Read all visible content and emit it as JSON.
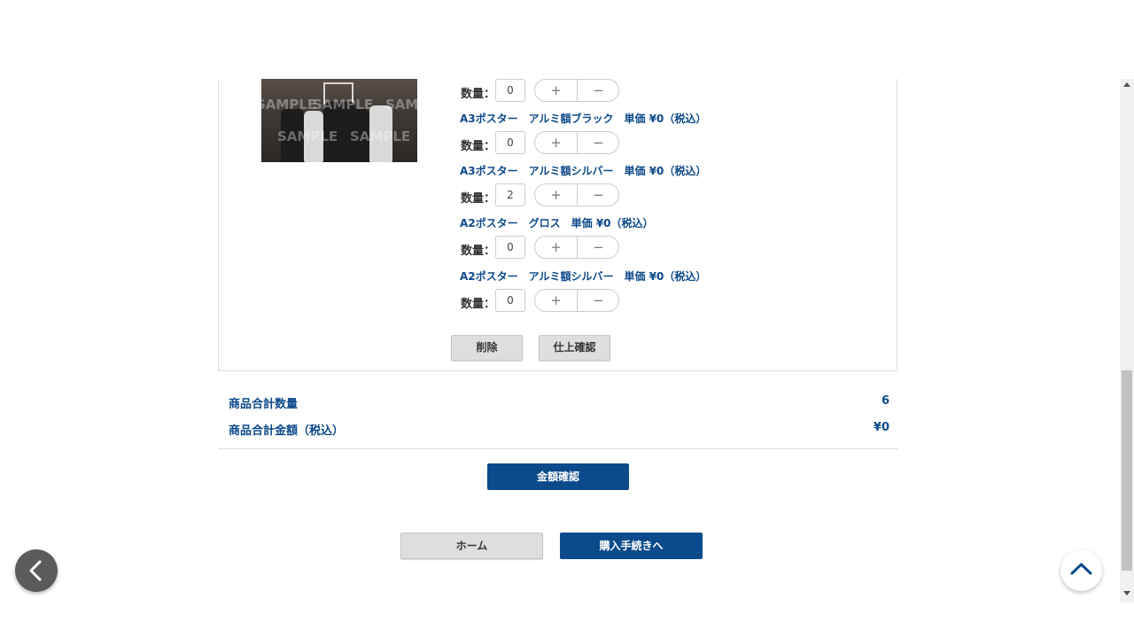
{
  "thumbnail": {
    "watermark": "SAMPLE"
  },
  "quantity_label": "数量：",
  "quantity_rows": [
    {
      "value": "0"
    },
    {
      "title": "A3ポスター　アルミ額ブラック　単価 ¥0（税込）",
      "value": "0"
    },
    {
      "title": "A3ポスター　アルミ額シルバー　単価 ¥0（税込）",
      "value": "2"
    },
    {
      "title": "A2ポスター　グロス　単価 ¥0（税込）",
      "value": "0"
    },
    {
      "title": "A2ポスター　アルミ額シルバー　単価 ¥0（税込）",
      "value": "0"
    }
  ],
  "stepper": {
    "plus": "+",
    "minus": "−"
  },
  "actions": {
    "delete": "削除",
    "finish_check": "仕上確認"
  },
  "summary": {
    "total_qty_label": "商品合計数量",
    "total_qty_value": "6",
    "total_price_label": "商品合計金額（税込）",
    "total_price_value": "¥0"
  },
  "price_confirm": "金額確認",
  "nav": {
    "home": "ホーム",
    "checkout": "購入手続きへ"
  },
  "icons": {
    "back": "chevron-left-icon",
    "top": "chevron-up-icon"
  },
  "colors": {
    "accent": "#0b4a8b",
    "label_blue": "#0d4a8a",
    "gray_button": "#dedede"
  }
}
